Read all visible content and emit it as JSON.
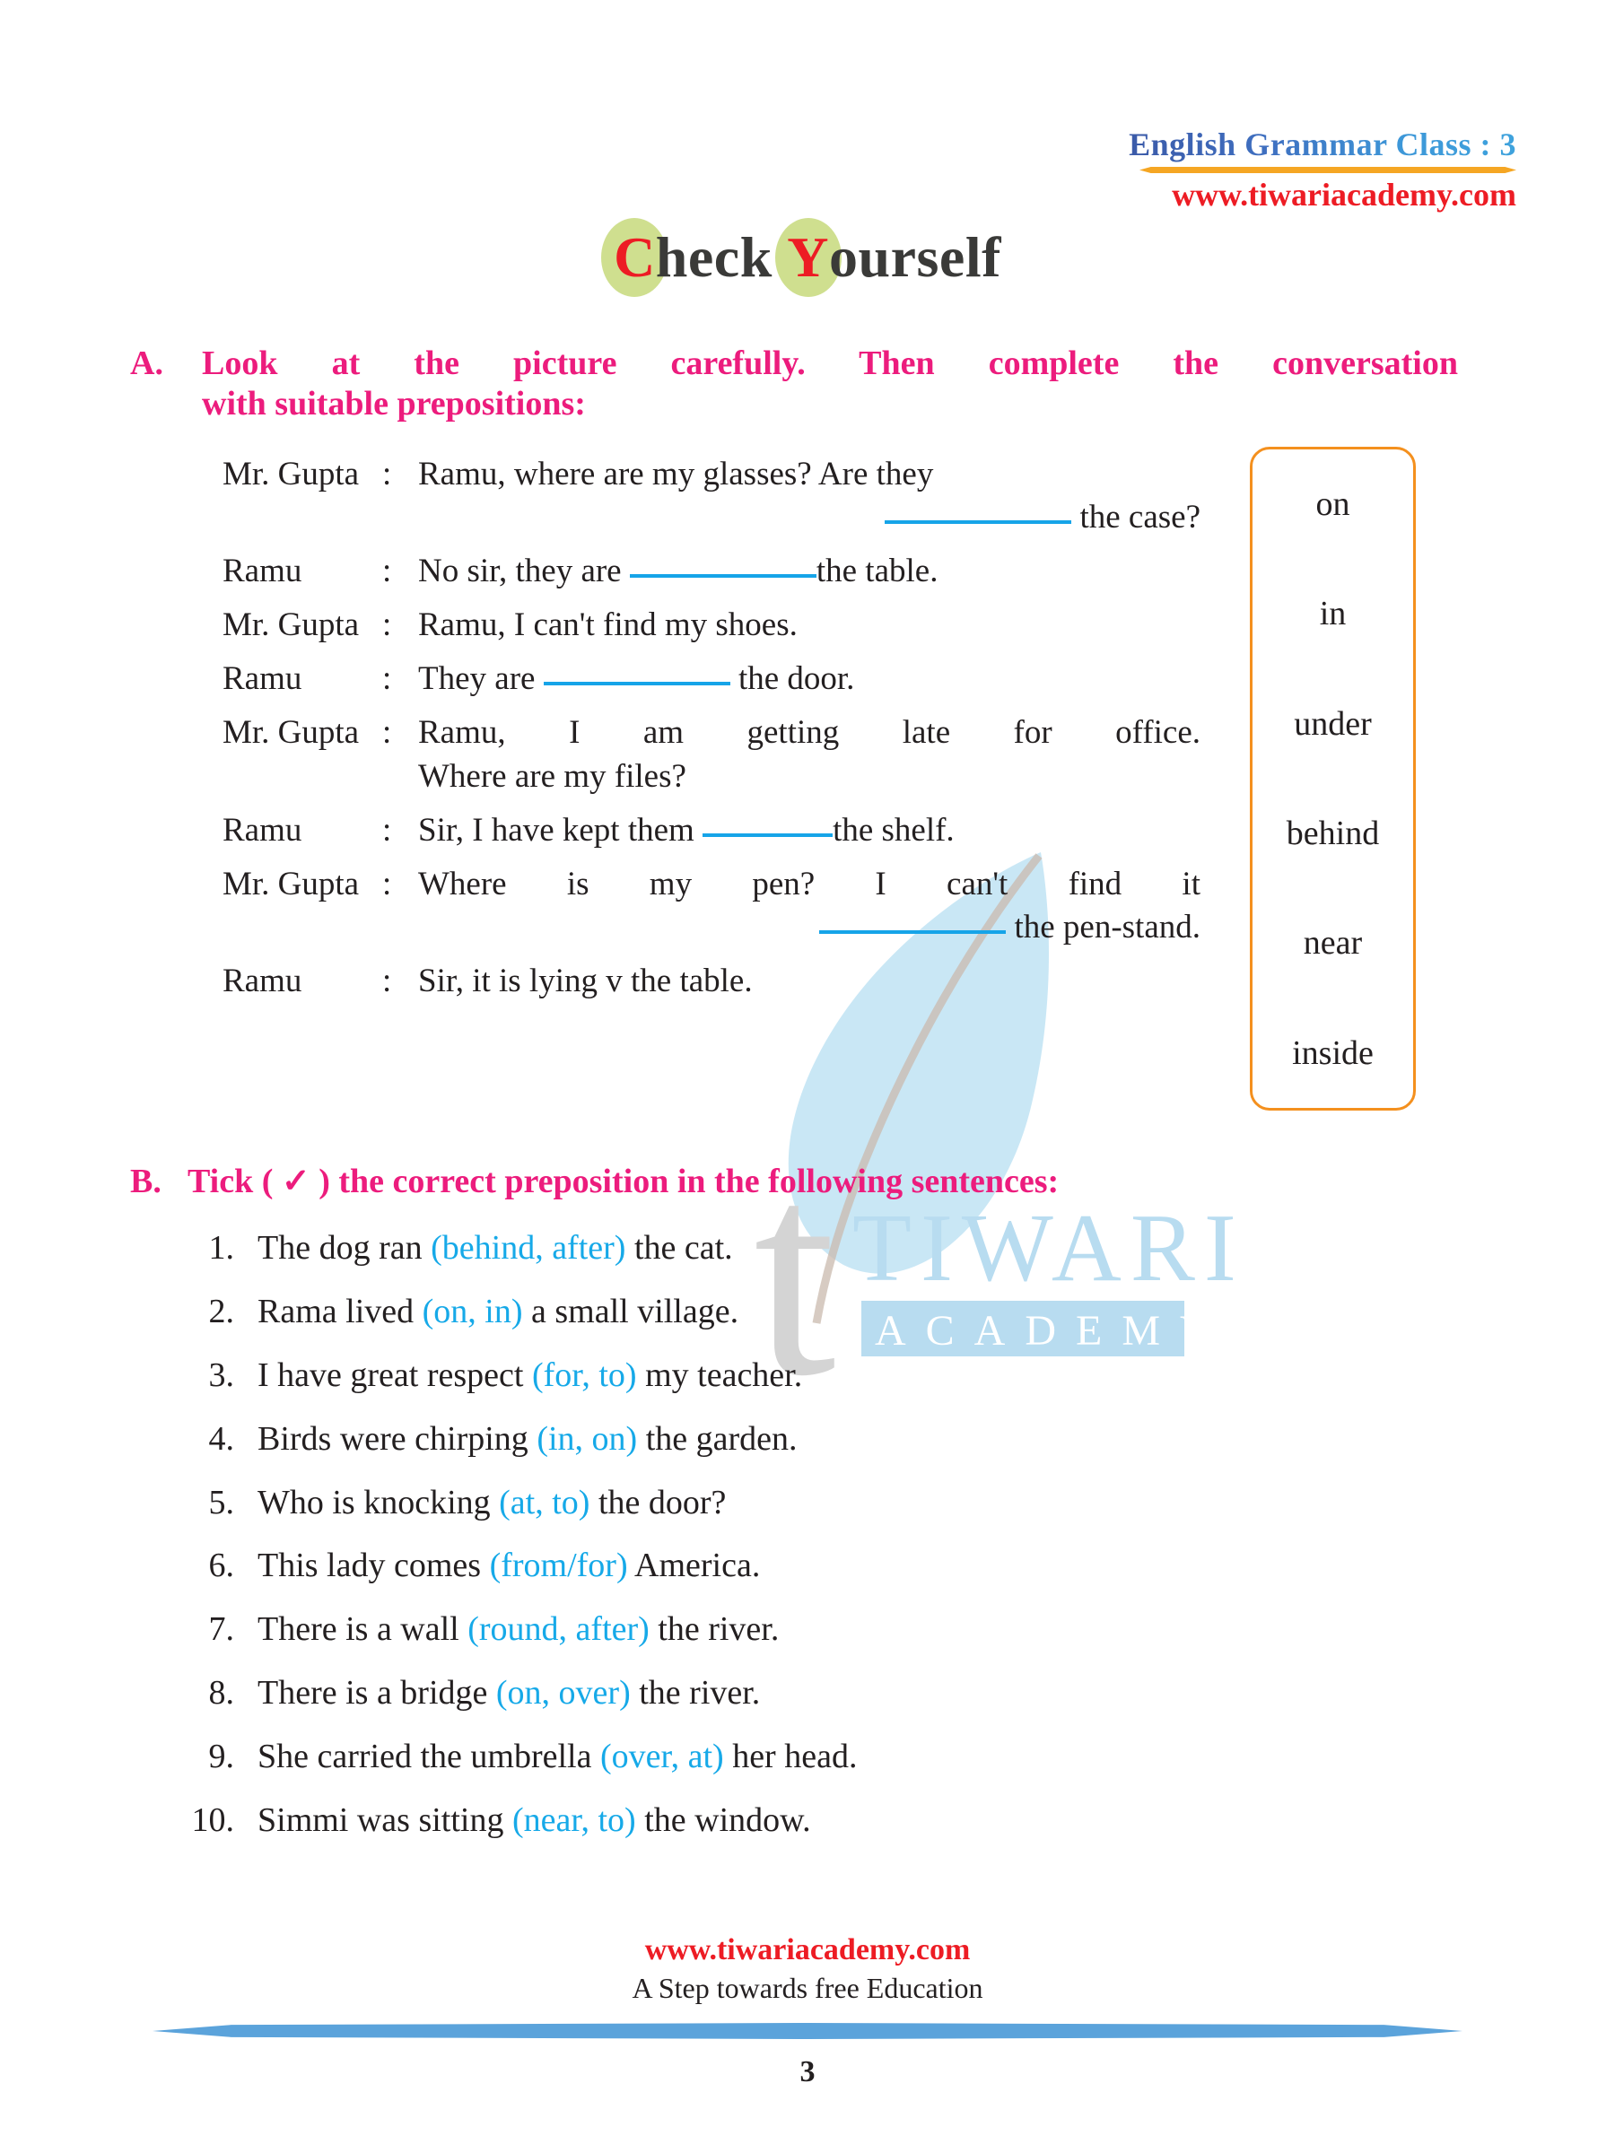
{
  "header": {
    "course_title": "English Grammar Class : 3",
    "website": "www.tiwariacademy.com"
  },
  "title": {
    "first_letter": "C",
    "first_rest": "heck",
    "second_letter": "Y",
    "second_rest": "ourself",
    "highlight_color": "#cfdf8f",
    "letter_color": "#ed1c24"
  },
  "watermark": {
    "brand": "TIWARI",
    "sub": "ACADEMY",
    "letter": "t"
  },
  "section_a": {
    "letter": "A.",
    "heading_line1": "Look at the picture carefully. Then complete the conversation",
    "heading_line2": "with suitable prepositions:",
    "accent_color": "#ec1c7d",
    "dialogue": [
      {
        "speaker": "Mr. Gupta",
        "colon": ":",
        "line1": "Ramu, where are my glasses? Are they",
        "line2_pre": "",
        "line2_post": "the case?",
        "blank": "long",
        "blank_on_line": 2,
        "line2_align": "right"
      },
      {
        "speaker": "Ramu",
        "colon": ":",
        "line1_pre": "No sir, they are",
        "line1_post": "the table.",
        "blank": "long",
        "blank_on_line": 1
      },
      {
        "speaker": "Mr. Gupta",
        "colon": ":",
        "line1": "Ramu, I can't find my shoes.",
        "blank": "none"
      },
      {
        "speaker": "Ramu",
        "colon": ":",
        "line1_pre": "They are",
        "line1_post": "the door.",
        "blank": "long",
        "blank_on_line": 1
      },
      {
        "speaker": "Mr. Gupta",
        "colon": ":",
        "line1": "Ramu, I am getting late for office.",
        "line2": "Where are my files?",
        "blank": "none"
      },
      {
        "speaker": "Ramu",
        "colon": ":",
        "line1_pre": "Sir, I have kept them",
        "line1_post": "the shelf.",
        "blank": "short",
        "blank_on_line": 1
      },
      {
        "speaker": "Mr. Gupta",
        "colon": ":",
        "line1": "Where is my pen? I can't find it",
        "line2_pre": "",
        "line2_post": "the pen-stand.",
        "blank": "long",
        "blank_on_line": 2,
        "line2_align": "right"
      },
      {
        "speaker": "Ramu",
        "colon": ":",
        "line1": "Sir, it is lying v the table.",
        "blank": "none"
      }
    ],
    "word_box": {
      "border_color": "#f4901e",
      "words": [
        "on",
        "in",
        "under",
        "behind",
        "near",
        "inside"
      ]
    }
  },
  "section_b": {
    "letter": "B.",
    "heading": "Tick ( ✓ ) the correct preposition in the following sentences:",
    "accent_color": "#ec1c7d",
    "option_color": "#16a9e8",
    "questions": [
      {
        "num": "1.",
        "pre": "The dog ran ",
        "options": "(behind, after)",
        "post": " the cat."
      },
      {
        "num": "2.",
        "pre": "Rama lived ",
        "options": "(on, in)",
        "post": " a small village."
      },
      {
        "num": "3.",
        "pre": "I have great respect ",
        "options": "(for, to)",
        "post": " my teacher."
      },
      {
        "num": "4.",
        "pre": "Birds were chirping ",
        "options": "(in, on)",
        "post": " the garden."
      },
      {
        "num": "5.",
        "pre": "Who is knocking ",
        "options": "(at, to)",
        "post": " the door?"
      },
      {
        "num": "6.",
        "pre": "This lady comes ",
        "options": "(from/for)",
        "post": " America."
      },
      {
        "num": "7.",
        "pre": "There is a wall ",
        "options": "(round, after)",
        "post": " the river."
      },
      {
        "num": "8.",
        "pre": "There is a bridge ",
        "options": "(on, over)",
        "post": " the river."
      },
      {
        "num": "9.",
        "pre": "She carried the umbrella ",
        "options": "(over, at)",
        "post": " her head."
      },
      {
        "num": "10.",
        "pre": "Simmi was sitting ",
        "options": "(near, to)",
        "post": " the window."
      }
    ]
  },
  "footer": {
    "website": "www.tiwariacademy.com",
    "tagline": "A Step towards free Education",
    "page_number": "3",
    "bar_color": "#5ba3db"
  }
}
